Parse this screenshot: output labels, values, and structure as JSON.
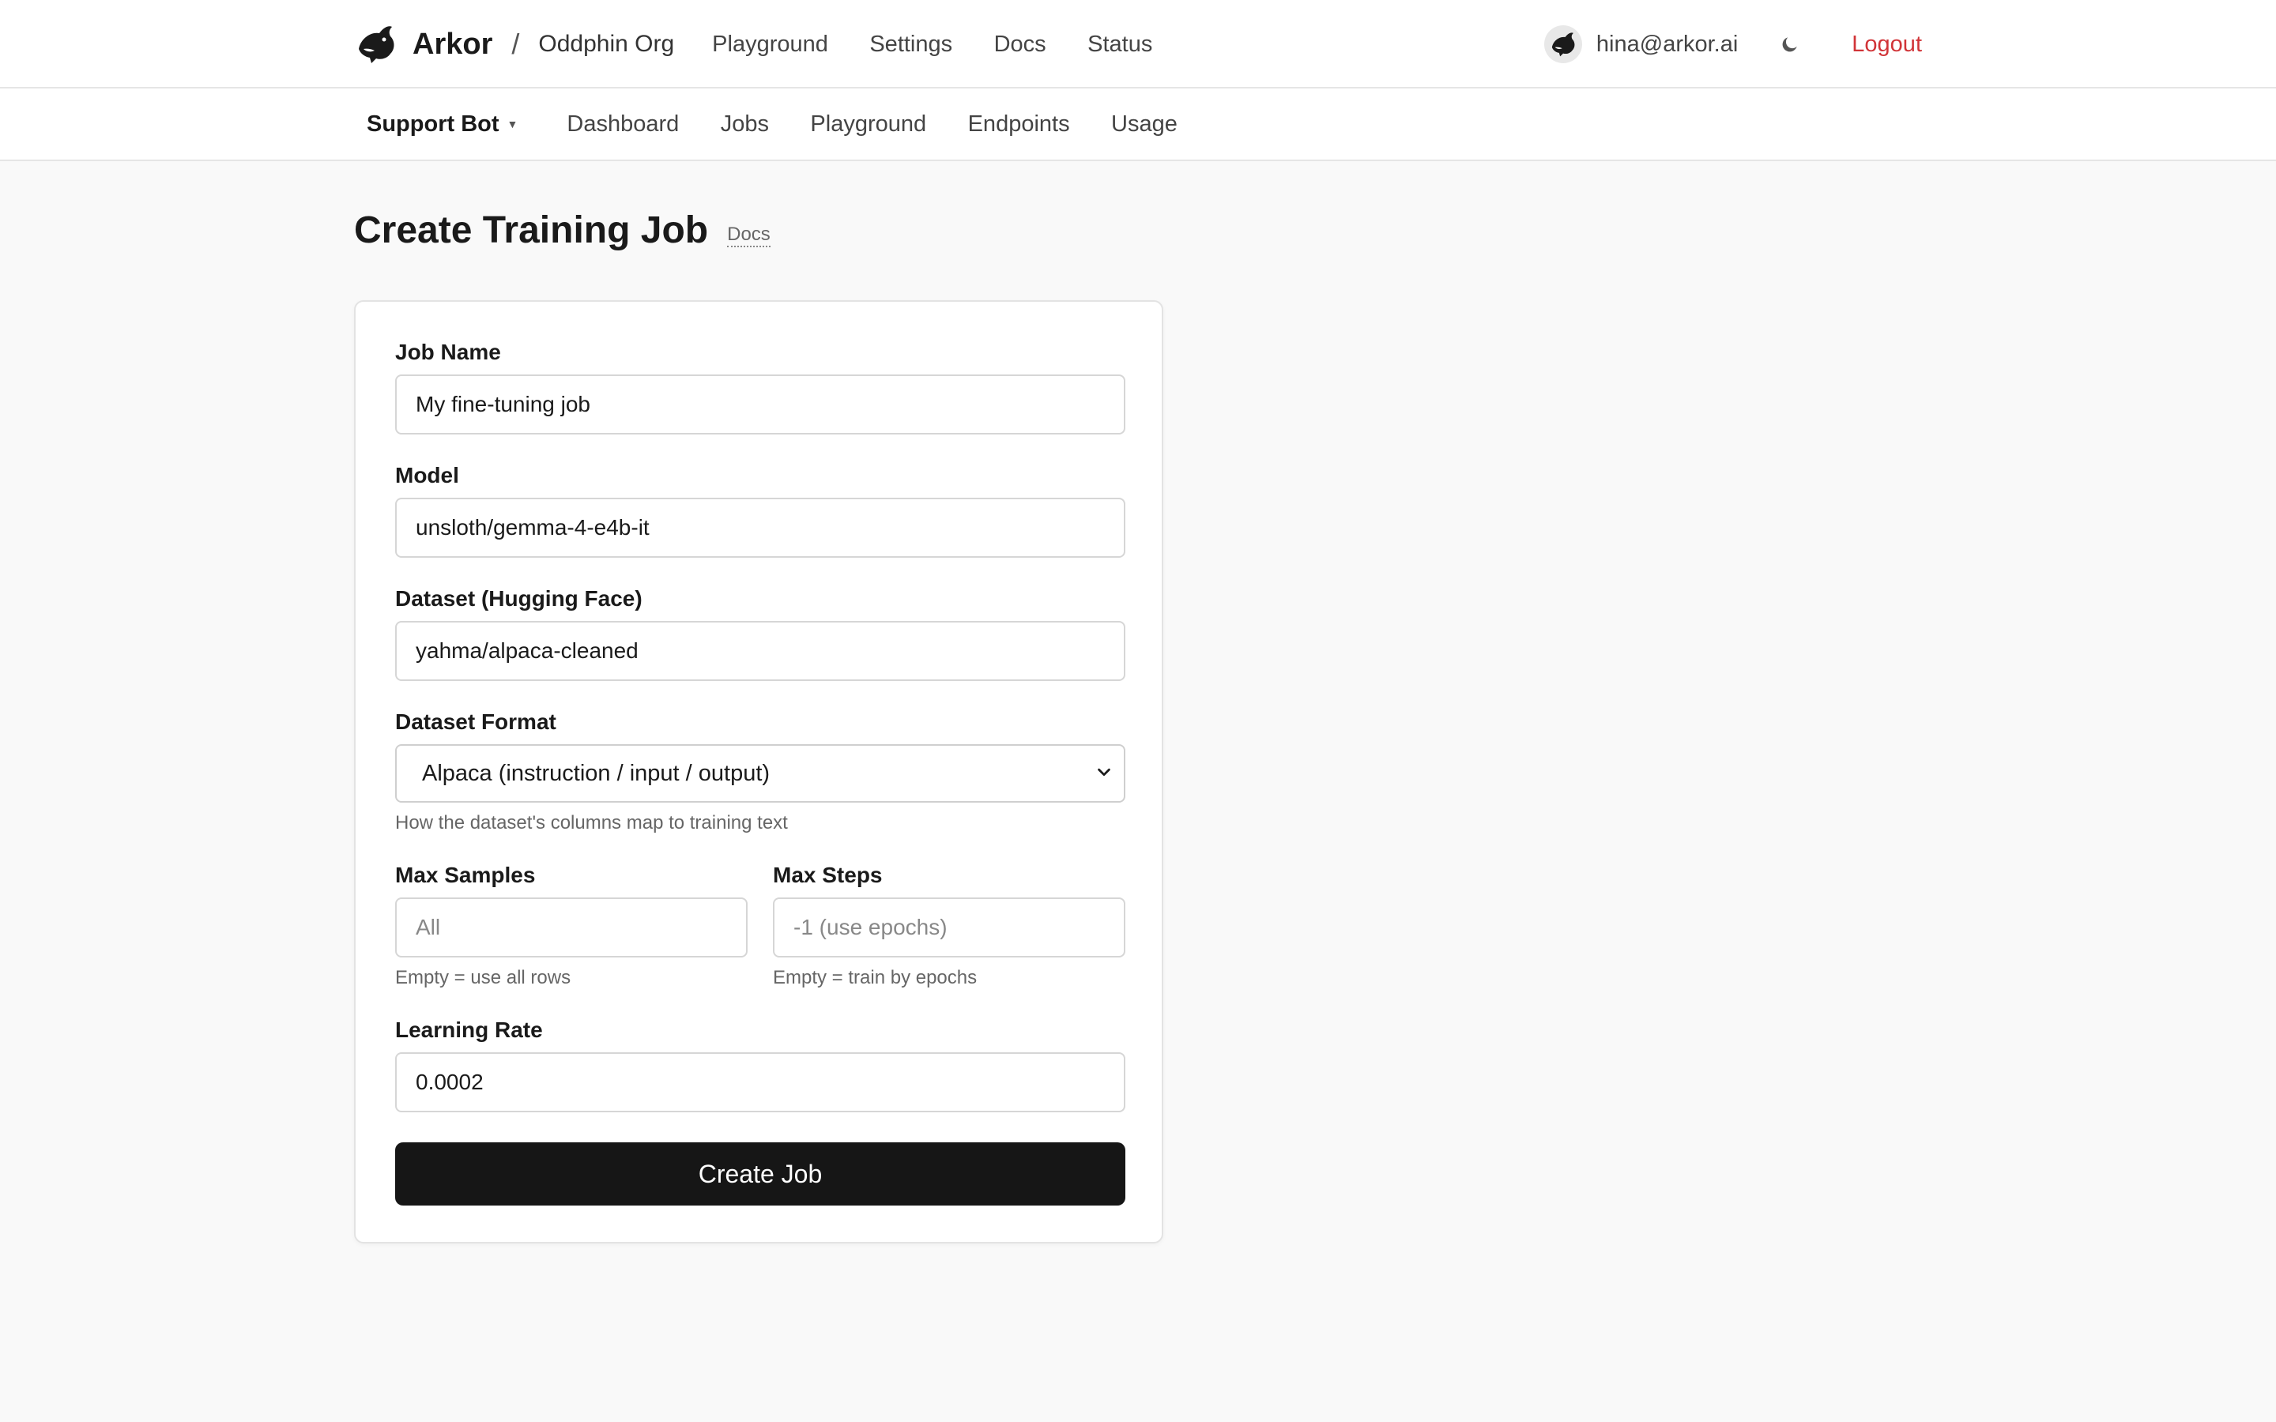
{
  "header": {
    "brand": "Arkor",
    "separator": "/",
    "org": "Oddphin Org",
    "nav": [
      "Playground",
      "Settings",
      "Docs",
      "Status"
    ],
    "user_email": "hina@arkor.ai",
    "logout_label": "Logout"
  },
  "subheader": {
    "project": "Support Bot",
    "nav": [
      "Dashboard",
      "Jobs",
      "Playground",
      "Endpoints",
      "Usage"
    ]
  },
  "page": {
    "title": "Create Training Job",
    "docs_link": "Docs"
  },
  "form": {
    "job_name": {
      "label": "Job Name",
      "value": "My fine-tuning job"
    },
    "model": {
      "label": "Model",
      "value": "unsloth/gemma-4-e4b-it"
    },
    "dataset": {
      "label": "Dataset (Hugging Face)",
      "value": "yahma/alpaca-cleaned"
    },
    "dataset_format": {
      "label": "Dataset Format",
      "selected": "Alpaca (instruction / input / output)",
      "hint": "How the dataset's columns map to training text"
    },
    "max_samples": {
      "label": "Max Samples",
      "placeholder": "All",
      "hint": "Empty = use all rows"
    },
    "max_steps": {
      "label": "Max Steps",
      "placeholder": "-1 (use epochs)",
      "hint": "Empty = train by epochs"
    },
    "learning_rate": {
      "label": "Learning Rate",
      "value": "0.0002"
    },
    "submit_label": "Create Job"
  },
  "colors": {
    "accent_logout": "#d13438",
    "button_bg": "#161616",
    "page_bg": "#f9f9f9"
  },
  "icons": {
    "logo": "orca-logo-icon",
    "avatar": "orca-avatar-icon",
    "theme": "moon-icon",
    "select_caret": "chevron-down-icon",
    "project_caret": "caret-down-icon"
  }
}
